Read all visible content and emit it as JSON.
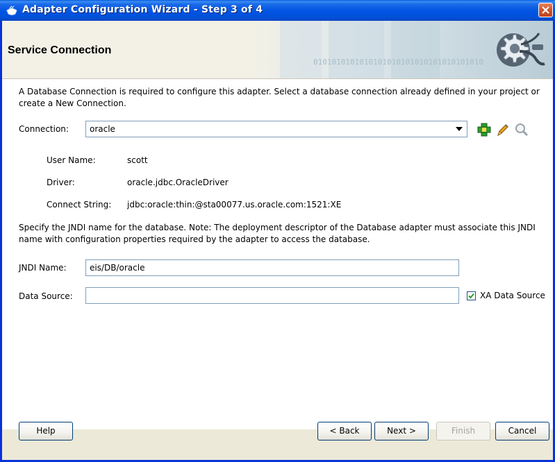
{
  "window": {
    "title": "Adapter Configuration Wizard - Step 3 of 4"
  },
  "banner": {
    "heading": "Service Connection",
    "watermark_text": "0101010101010101010101010101010101010"
  },
  "intro": {
    "text": "A Database Connection is required to configure this adapter. Select a database connection already defined in your project or create a New Connection."
  },
  "connection": {
    "label": "Connection:",
    "value": "oracle",
    "icons": [
      "add-connection-icon",
      "edit-pencil-icon",
      "browse-magnifier-icon"
    ]
  },
  "details": {
    "user_name_label": "User Name:",
    "user_name_value": "scott",
    "driver_label": "Driver:",
    "driver_value": "oracle.jdbc.OracleDriver",
    "connect_string_label": "Connect String:",
    "connect_string_value": "jdbc:oracle:thin:@sta00077.us.oracle.com:1521:XE"
  },
  "jndi_note": {
    "text": "Specify the JNDI name for the database.  Note: The deployment descriptor of the Database adapter must associate this JNDI name with configuration properties required by the adapter to access the database."
  },
  "jndi": {
    "label": "JNDI Name:",
    "value": "eis/DB/oracle"
  },
  "data_source": {
    "label": "Data Source:",
    "value": "",
    "xa_label": "XA Data Source",
    "xa_checked": true
  },
  "buttons": {
    "help": "Help",
    "back": "< Back",
    "next": "Next >",
    "finish": "Finish",
    "cancel": "Cancel"
  },
  "colors": {
    "titlebar": "#0054e3",
    "close_button": "#d4552a",
    "window_border": "#0831d9",
    "field_border": "#7f9db9",
    "add_icon_green": "#2e9d2e",
    "pencil_orange": "#e8a317"
  }
}
